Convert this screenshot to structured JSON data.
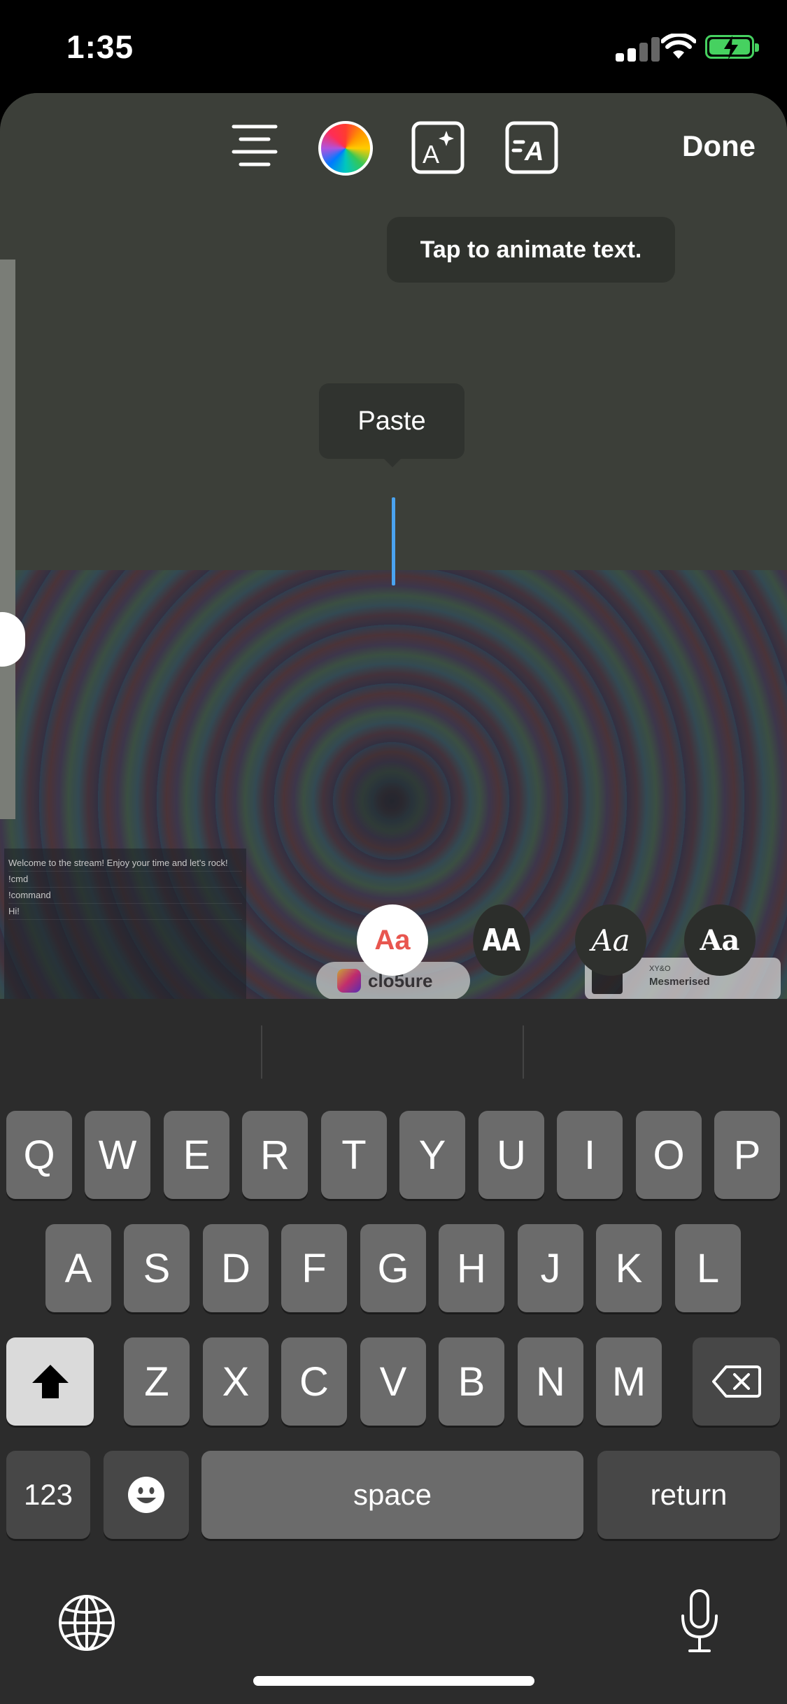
{
  "status_bar": {
    "time": "1:35"
  },
  "toolbar": {
    "align_icon": "text-align-center-icon",
    "color_icon": "color-wheel-icon",
    "effect_icon": "text-effect-sparkle-icon",
    "animate_icon": "text-animate-icon",
    "done_label": "Done"
  },
  "tooltip": {
    "animate_text": "Tap to animate text."
  },
  "edit_menu": {
    "paste_label": "Paste"
  },
  "font_styles": [
    {
      "label": "Aa"
    },
    {
      "label": "AA"
    },
    {
      "label": "Aa"
    },
    {
      "label": "Aa"
    }
  ],
  "background": {
    "chat_lines": [
      "Welcome to the stream! Enjoy your time and let's rock!",
      "!cmd",
      "!command",
      "Hi!"
    ],
    "ig_handle": "clo5ure",
    "song": {
      "artist": "XY&O",
      "title": "Mesmerised"
    }
  },
  "keyboard": {
    "row1": [
      "Q",
      "W",
      "E",
      "R",
      "T",
      "Y",
      "U",
      "I",
      "O",
      "P"
    ],
    "row2": [
      "A",
      "S",
      "D",
      "F",
      "G",
      "H",
      "J",
      "K",
      "L"
    ],
    "row3": [
      "Z",
      "X",
      "C",
      "V",
      "B",
      "N",
      "M"
    ],
    "numbers_label": "123",
    "space_label": "space",
    "return_label": "return"
  }
}
